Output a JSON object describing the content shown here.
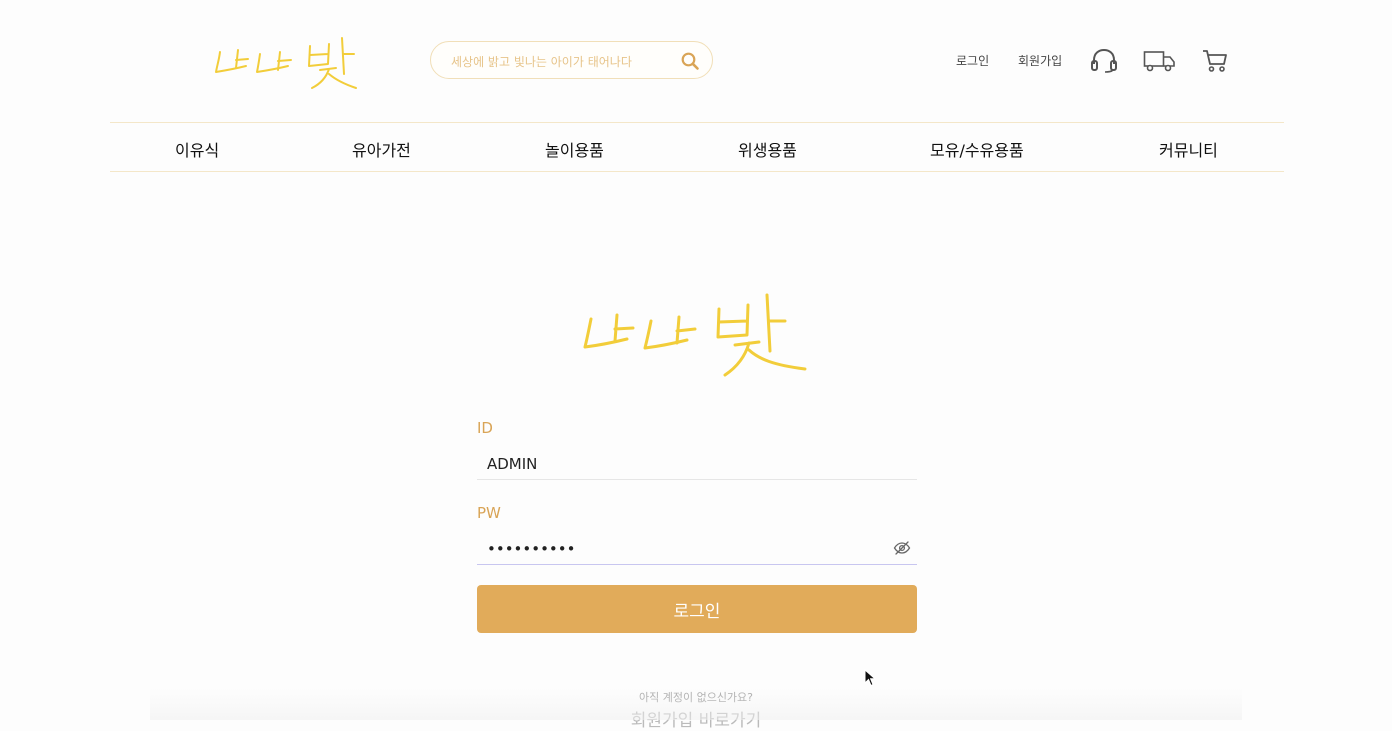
{
  "header": {
    "logo_text": "나나빛",
    "search_placeholder": "세상에 밝고 빛나는 아이가 태어나다",
    "login_link": "로그인",
    "signup_link": "회원가입",
    "icons": [
      "headset-icon",
      "truck-icon",
      "cart-icon"
    ]
  },
  "nav": {
    "items": [
      "이유식",
      "유아가전",
      "놀이용품",
      "위생용품",
      "모유/수유용품",
      "커뮤니티"
    ]
  },
  "login_form": {
    "logo_text": "나나빛",
    "id_label": "ID",
    "id_value": "ADMIN",
    "pw_label": "PW",
    "pw_value": "••••••••••",
    "submit_label": "로그인"
  },
  "signup": {
    "question": "아직 계정이 없으신가요?",
    "link": "회원가입 바로가기"
  },
  "colors": {
    "accent": "#e1ab5a",
    "label": "#d9a456",
    "logo": "#f2cd3a",
    "border": "#f4e7c9"
  }
}
